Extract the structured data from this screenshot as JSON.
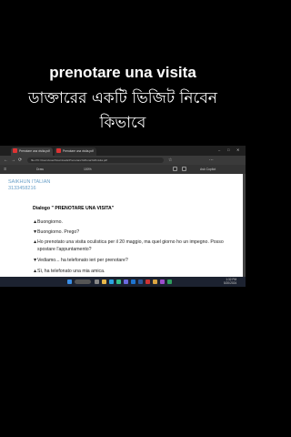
{
  "overlay": {
    "line1": "prenotare una visita",
    "line2": "ডাক্তারের একটি ভিজিট নিবেন",
    "line3": "কিভাবে"
  },
  "browser": {
    "tabs": [
      "Prenotare una visita.pdf",
      "Prenotare una visita.pdf"
    ],
    "address": "file:///C:/Users/user/Downloads/Prenotare%20una%20visita.pdf",
    "pdf_toolbar": {
      "draw_label": "Draw",
      "zoom": "100%",
      "ask_label": "Ask Copilot"
    }
  },
  "document": {
    "brand_name": "SAIKHUN ITALIAN",
    "brand_phone": "3133458216",
    "title": "Dialogo \" PRENOTARE UNA VISITA\"",
    "lines": [
      {
        "mark": "▲",
        "text": "Buongiorno."
      },
      {
        "mark": "▼",
        "text": "Buongiorno. Prego?"
      },
      {
        "mark": "▲",
        "text": "Ho prenotato una visita oculistica per il 20 maggio, ma quel giorno ho un impegno. Posso"
      },
      {
        "mark": "",
        "text": "spostare l'appuntamento?"
      },
      {
        "mark": "▼",
        "text": "Vediamo... ha telefonato ieri per prenotare?"
      },
      {
        "mark": "▲",
        "text": "Sì, ha telefonato una mia amica."
      }
    ]
  },
  "taskbar": {
    "time": "1:32 PM",
    "date": "5/20/2024"
  },
  "colors": {
    "brand": "#6aa0c8",
    "page": "#ffffff",
    "browser_dark": "#2b2b2b"
  }
}
